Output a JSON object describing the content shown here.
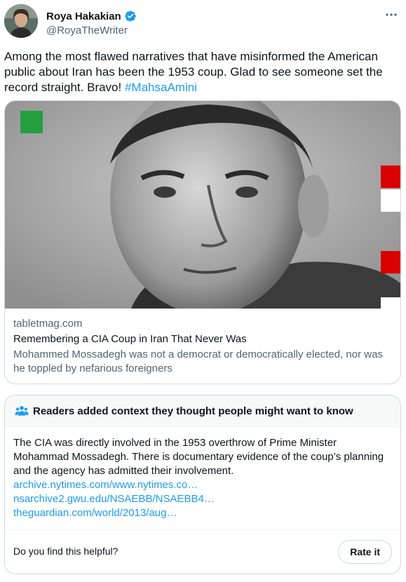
{
  "author": {
    "name": "Roya Hakakian",
    "handle": "@RoyaTheWriter",
    "verified": true,
    "verified_color": "#1d9bf0"
  },
  "tweet": {
    "text": "Among the most flawed narratives that have misinformed the American public about Iran has been the 1953 coup. Glad to see someone set the record straight. Bravo! ",
    "hashtag": "#MahsaAmini"
  },
  "card": {
    "domain": "tabletmag.com",
    "title": "Remembering a CIA Coup in Iran That Never Was",
    "description": "Mohammed Mossadegh was not a democrat or democratically elected, nor was he toppled by nefarious foreigners",
    "image_icon": "portrait-photo"
  },
  "community_note": {
    "header": "Readers added context they thought people might want to know",
    "body": "The CIA was directly involved in the 1953 overthrow of Prime Minister Mohammad Mossadegh. There is documentary evidence of the coup’s planning and the agency has admitted their involvement.",
    "links": [
      "archive.nytimes.com/www.nytimes.co…",
      "nsarchive2.gwu.edu/NSAEBB/NSAEBB4…",
      "theguardian.com/world/2013/aug…"
    ],
    "helpful_prompt": "Do you find this helpful?",
    "rate_label": "Rate it"
  },
  "colors": {
    "link": "#1d9bf0",
    "secondary_text": "#536471",
    "border": "#cfd9de",
    "flag_green": "#239f40",
    "flag_red": "#da0000"
  }
}
